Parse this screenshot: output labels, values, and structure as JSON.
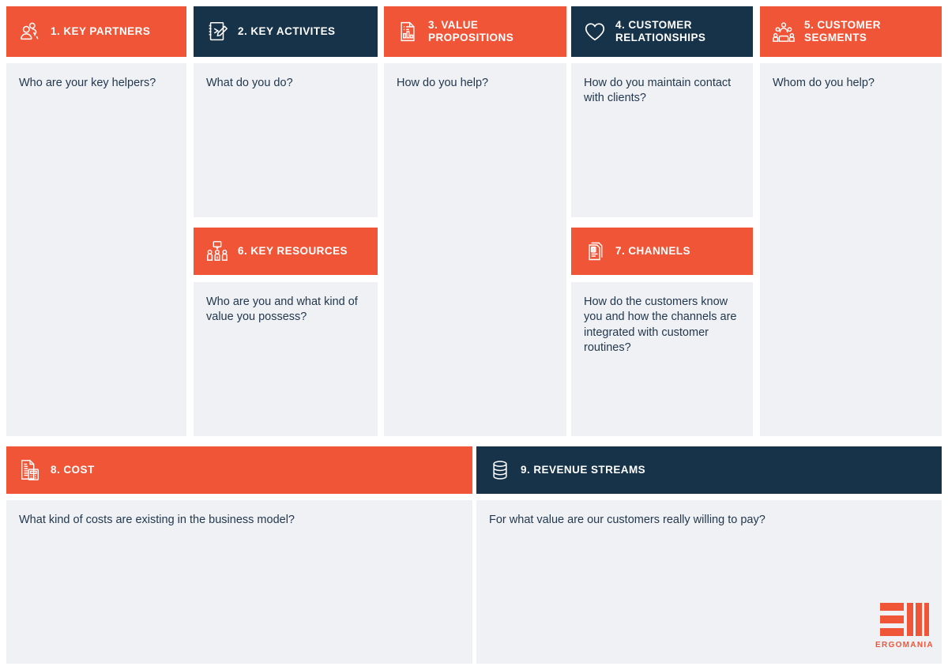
{
  "colors": {
    "orange": "#F05538",
    "navy": "#17334A",
    "cell_bg": "#EFF1F5",
    "text": "#23384D",
    "page_bg": "#FFFFFF"
  },
  "blocks": [
    {
      "id": "key-partners",
      "number": "1.",
      "title": "1. KEY PARTNERS",
      "icon": "partners-icon",
      "header_color": "orange",
      "body": "Who are your key helpers?"
    },
    {
      "id": "key-activites",
      "number": "2.",
      "title": "2. KEY ACTIVITES",
      "icon": "notebook-pen-icon",
      "header_color": "navy",
      "body": "What do you do?"
    },
    {
      "id": "value-propositions",
      "number": "3.",
      "title": "3. VALUE\nPROPOSITIONS",
      "icon": "document-chart-icon",
      "header_color": "orange",
      "body": "How do you help?"
    },
    {
      "id": "customer-relationships",
      "number": "4.",
      "title": "4. CUSTOMER\nRELATIONSHIPS",
      "icon": "heart-icon",
      "header_color": "navy",
      "body": "How do you maintain contact with clients?"
    },
    {
      "id": "customer-segments",
      "number": "5.",
      "title": "5. CUSTOMER\nSEGMENTS",
      "icon": "people-group-icon",
      "header_color": "orange",
      "body": "Whom do you help?"
    },
    {
      "id": "key-resources",
      "number": "6.",
      "title": "6. KEY RESOURCES",
      "icon": "team-speech-icon",
      "header_color": "orange",
      "body": "Who are you and what kind of value you possess?"
    },
    {
      "id": "channels",
      "number": "7.",
      "title": "7. CHANNELS",
      "icon": "id-cards-icon",
      "header_color": "orange",
      "body": "How do the customers know you and how the channels are integrated with customer routines?"
    },
    {
      "id": "cost",
      "number": "8.",
      "title": "8. COST",
      "icon": "invoice-calculator-icon",
      "header_color": "orange",
      "body": "What kind of costs are existing in the business model?"
    },
    {
      "id": "revenue-streams",
      "number": "9.",
      "title": "9. REVENUE STREAMS",
      "icon": "coin-stack-icon",
      "header_color": "navy",
      "body": "For what value are our customers really willing to pay?"
    }
  ],
  "logo": {
    "wordmark": "ERGOMANIA",
    "color": "#F05538"
  }
}
